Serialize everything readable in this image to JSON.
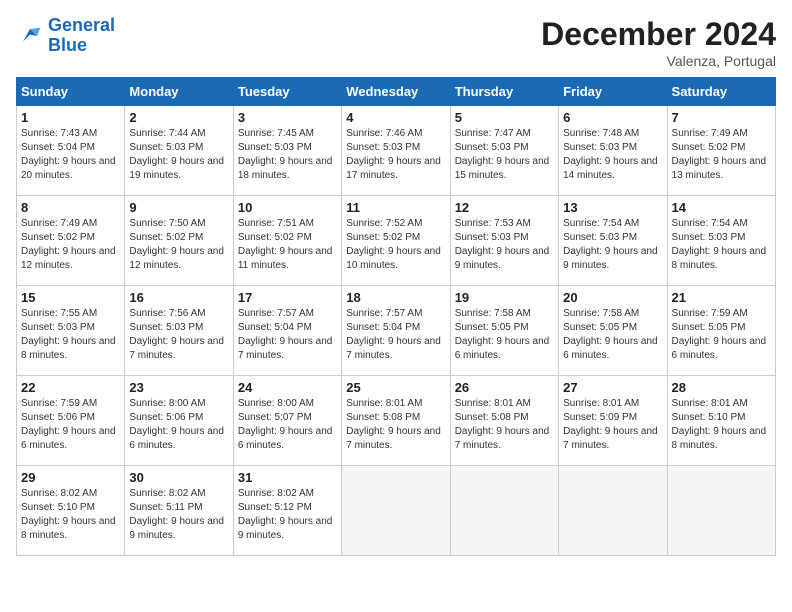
{
  "header": {
    "logo_general": "General",
    "logo_blue": "Blue",
    "month_title": "December 2024",
    "location": "Valenza, Portugal"
  },
  "weekdays": [
    "Sunday",
    "Monday",
    "Tuesday",
    "Wednesday",
    "Thursday",
    "Friday",
    "Saturday"
  ],
  "weeks": [
    [
      {
        "day": 1,
        "sunrise": "7:43 AM",
        "sunset": "5:04 PM",
        "daylight": "9 hours and 20 minutes."
      },
      {
        "day": 2,
        "sunrise": "7:44 AM",
        "sunset": "5:03 PM",
        "daylight": "9 hours and 19 minutes."
      },
      {
        "day": 3,
        "sunrise": "7:45 AM",
        "sunset": "5:03 PM",
        "daylight": "9 hours and 18 minutes."
      },
      {
        "day": 4,
        "sunrise": "7:46 AM",
        "sunset": "5:03 PM",
        "daylight": "9 hours and 17 minutes."
      },
      {
        "day": 5,
        "sunrise": "7:47 AM",
        "sunset": "5:03 PM",
        "daylight": "9 hours and 15 minutes."
      },
      {
        "day": 6,
        "sunrise": "7:48 AM",
        "sunset": "5:03 PM",
        "daylight": "9 hours and 14 minutes."
      },
      {
        "day": 7,
        "sunrise": "7:49 AM",
        "sunset": "5:02 PM",
        "daylight": "9 hours and 13 minutes."
      }
    ],
    [
      {
        "day": 8,
        "sunrise": "7:49 AM",
        "sunset": "5:02 PM",
        "daylight": "9 hours and 12 minutes."
      },
      {
        "day": 9,
        "sunrise": "7:50 AM",
        "sunset": "5:02 PM",
        "daylight": "9 hours and 12 minutes."
      },
      {
        "day": 10,
        "sunrise": "7:51 AM",
        "sunset": "5:02 PM",
        "daylight": "9 hours and 11 minutes."
      },
      {
        "day": 11,
        "sunrise": "7:52 AM",
        "sunset": "5:02 PM",
        "daylight": "9 hours and 10 minutes."
      },
      {
        "day": 12,
        "sunrise": "7:53 AM",
        "sunset": "5:03 PM",
        "daylight": "9 hours and 9 minutes."
      },
      {
        "day": 13,
        "sunrise": "7:54 AM",
        "sunset": "5:03 PM",
        "daylight": "9 hours and 9 minutes."
      },
      {
        "day": 14,
        "sunrise": "7:54 AM",
        "sunset": "5:03 PM",
        "daylight": "9 hours and 8 minutes."
      }
    ],
    [
      {
        "day": 15,
        "sunrise": "7:55 AM",
        "sunset": "5:03 PM",
        "daylight": "9 hours and 8 minutes."
      },
      {
        "day": 16,
        "sunrise": "7:56 AM",
        "sunset": "5:03 PM",
        "daylight": "9 hours and 7 minutes."
      },
      {
        "day": 17,
        "sunrise": "7:57 AM",
        "sunset": "5:04 PM",
        "daylight": "9 hours and 7 minutes."
      },
      {
        "day": 18,
        "sunrise": "7:57 AM",
        "sunset": "5:04 PM",
        "daylight": "9 hours and 7 minutes."
      },
      {
        "day": 19,
        "sunrise": "7:58 AM",
        "sunset": "5:05 PM",
        "daylight": "9 hours and 6 minutes."
      },
      {
        "day": 20,
        "sunrise": "7:58 AM",
        "sunset": "5:05 PM",
        "daylight": "9 hours and 6 minutes."
      },
      {
        "day": 21,
        "sunrise": "7:59 AM",
        "sunset": "5:05 PM",
        "daylight": "9 hours and 6 minutes."
      }
    ],
    [
      {
        "day": 22,
        "sunrise": "7:59 AM",
        "sunset": "5:06 PM",
        "daylight": "9 hours and 6 minutes."
      },
      {
        "day": 23,
        "sunrise": "8:00 AM",
        "sunset": "5:06 PM",
        "daylight": "9 hours and 6 minutes."
      },
      {
        "day": 24,
        "sunrise": "8:00 AM",
        "sunset": "5:07 PM",
        "daylight": "9 hours and 6 minutes."
      },
      {
        "day": 25,
        "sunrise": "8:01 AM",
        "sunset": "5:08 PM",
        "daylight": "9 hours and 7 minutes."
      },
      {
        "day": 26,
        "sunrise": "8:01 AM",
        "sunset": "5:08 PM",
        "daylight": "9 hours and 7 minutes."
      },
      {
        "day": 27,
        "sunrise": "8:01 AM",
        "sunset": "5:09 PM",
        "daylight": "9 hours and 7 minutes."
      },
      {
        "day": 28,
        "sunrise": "8:01 AM",
        "sunset": "5:10 PM",
        "daylight": "9 hours and 8 minutes."
      }
    ],
    [
      {
        "day": 29,
        "sunrise": "8:02 AM",
        "sunset": "5:10 PM",
        "daylight": "9 hours and 8 minutes."
      },
      {
        "day": 30,
        "sunrise": "8:02 AM",
        "sunset": "5:11 PM",
        "daylight": "9 hours and 9 minutes."
      },
      {
        "day": 31,
        "sunrise": "8:02 AM",
        "sunset": "5:12 PM",
        "daylight": "9 hours and 9 minutes."
      },
      null,
      null,
      null,
      null
    ]
  ]
}
